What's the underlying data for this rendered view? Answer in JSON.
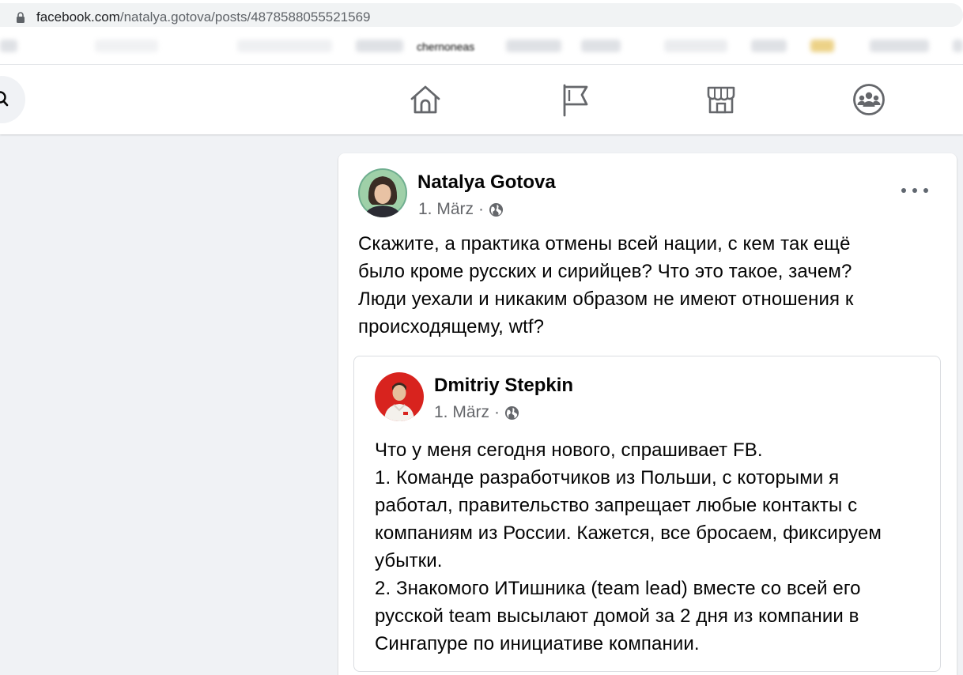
{
  "browser": {
    "url_host": "facebook.com",
    "url_path": "/natalya.gotova/posts/4878588055521569",
    "bookmark_label": "chernoneas"
  },
  "nav": {
    "icons": [
      "home-icon",
      "pages-flag-icon",
      "marketplace-icon",
      "groups-icon"
    ]
  },
  "post": {
    "author": "Natalya Gotova",
    "date": "1. März",
    "separator": "·",
    "text_lines": [
      "Скажите, а практика отмены всей нации, с кем так ещё",
      "было кроме русских и сирийцев? Что это такое, зачем?",
      "Люди уехали и никаким образом не имеют отношения к",
      "происходящему, wtf?"
    ],
    "shared": {
      "author": "Dmitriy Stepkin",
      "date": "1. März",
      "separator": "·",
      "text_lines": [
        "Что у меня сегодня нового, спрашивает FB.",
        "1. Команде разработчиков из Польши, с которыми я",
        "работал, правительство запрещает любые контакты с",
        "компаниям из России. Кажется, все бросаем, фиксируем",
        "убытки.",
        "2. Знакомого ИТишника (team lead) вместе со всей его",
        "русской team высылают домой за 2 дня из компании в",
        "Сингапуре по инициативе компании."
      ]
    }
  },
  "colors": {
    "page_bg": "#f0f2f5",
    "text_primary": "#050505",
    "text_secondary": "#65676b",
    "icon_gray": "#65676b"
  }
}
